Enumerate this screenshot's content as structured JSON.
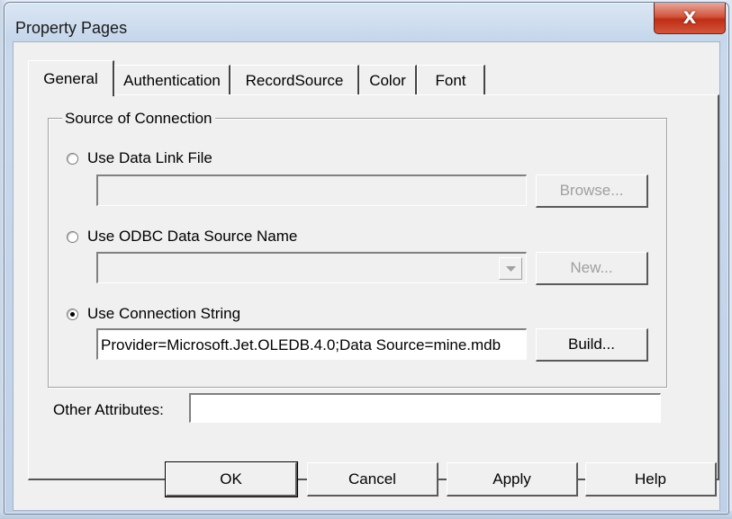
{
  "window": {
    "title": "Property Pages",
    "close_icon": "close-icon",
    "close_glyph": "X"
  },
  "tabs": [
    {
      "label": "General",
      "active": true
    },
    {
      "label": "Authentication",
      "active": false
    },
    {
      "label": "RecordSource",
      "active": false
    },
    {
      "label": "Color",
      "active": false
    },
    {
      "label": "Font",
      "active": false
    }
  ],
  "general": {
    "group_label": "Source of Connection",
    "options": {
      "data_link_file": {
        "label": "Use Data Link File",
        "checked": false,
        "value": "",
        "button": "Browse..."
      },
      "odbc": {
        "label": "Use ODBC Data Source Name",
        "checked": false,
        "value": "",
        "button": "New..."
      },
      "connection_string": {
        "label": "Use Connection String",
        "checked": true,
        "value": "Provider=Microsoft.Jet.OLEDB.4.0;Data Source=mine.mdb",
        "button": "Build..."
      }
    },
    "other_attributes": {
      "label": "Other Attributes:",
      "value": ""
    }
  },
  "buttons": {
    "ok": "OK",
    "cancel": "Cancel",
    "apply": "Apply",
    "help": "Help"
  }
}
